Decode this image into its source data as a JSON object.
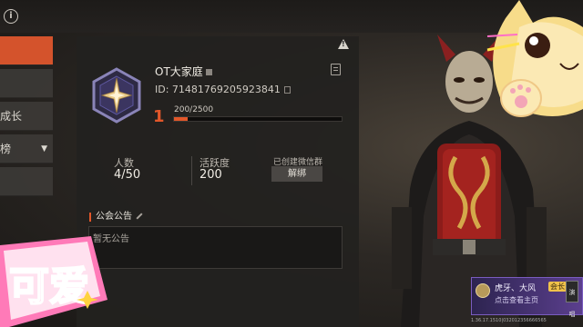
{
  "sidebar": {
    "items": [
      {
        "label": "",
        "active": true
      },
      {
        "label": ""
      },
      {
        "label": "成长"
      },
      {
        "label": "榜"
      },
      {
        "label": ""
      }
    ],
    "dropdown_glyph": "▼"
  },
  "guild": {
    "name": "OT大家庭",
    "id_label": "ID: 71481769205923841",
    "level": "1",
    "exp_text": "200/2500",
    "exp_progress": 0.08
  },
  "stats": {
    "members_label": "人数",
    "members_value": "4/50",
    "activity_label": "活跃度",
    "activity_value": "200",
    "wechat_label": "已创建微信群",
    "unbind_label": "解绑"
  },
  "announcement": {
    "title": "公会公告",
    "content": "暂无公告"
  },
  "sticker_text": "可爱",
  "profile_card": {
    "name": "虎牙、大风",
    "role": "会长",
    "subtitle": "点击查看主页",
    "button": "演唱"
  },
  "version": "1.36.17.1510|032012356666565",
  "colors": {
    "accent": "#e2572a",
    "active_tab": "#d4532c",
    "profile_card": "#5b3f8e"
  },
  "icons": [
    "info-icon",
    "warning-icon",
    "guild-emblem-icon",
    "edit-icon",
    "copy-icon",
    "notes-icon",
    "pencil-icon",
    "dropdown-arrow-icon"
  ]
}
